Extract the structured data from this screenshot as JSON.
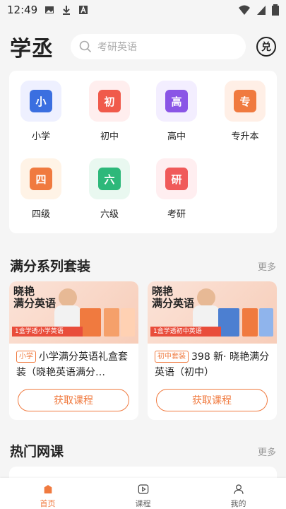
{
  "status": {
    "time": "12:49"
  },
  "header": {
    "logo": "学丞",
    "search_placeholder": "考研英语",
    "redeem_label": "兑"
  },
  "categories": [
    {
      "label": "小学",
      "badge": "小",
      "color": "#3b6fe0",
      "bg": "#eef0ff"
    },
    {
      "label": "初中",
      "badge": "初",
      "color": "#f05a4b",
      "bg": "#ffeeee"
    },
    {
      "label": "高中",
      "badge": "高",
      "color": "#8a55e6",
      "bg": "#f3eeff"
    },
    {
      "label": "专升本",
      "badge": "专",
      "color": "#f07a3f",
      "bg": "#ffefe6"
    },
    {
      "label": "四级",
      "badge": "四",
      "color": "#f07a3f",
      "bg": "#fff3e6"
    },
    {
      "label": "六级",
      "badge": "六",
      "color": "#2db87a",
      "bg": "#e9f8f0"
    },
    {
      "label": "考研",
      "badge": "研",
      "color": "#f05a5a",
      "bg": "#ffeef0"
    }
  ],
  "sections": {
    "series": {
      "title": "满分系列套装",
      "more": "更多"
    },
    "hot": {
      "title": "热门网课",
      "more": "更多"
    }
  },
  "products": [
    {
      "banner_title": "晓艳\n满分英语",
      "banner_sub": "1盒学透小学英语",
      "tag": "小学",
      "title": "小学满分英语礼盒套装（晓艳英语满分…",
      "button": "获取课程"
    },
    {
      "banner_title": "晓艳\n满分英语",
      "banner_sub": "1盒学透初中英语",
      "tag": "初中套装",
      "title": "398 新· 晓艳满分英语（初中）",
      "button": "获取课程"
    }
  ],
  "tabs": [
    {
      "label": "首页",
      "icon": "home-icon",
      "active": true
    },
    {
      "label": "课程",
      "icon": "play-icon",
      "active": false
    },
    {
      "label": "我的",
      "icon": "user-icon",
      "active": false
    }
  ]
}
